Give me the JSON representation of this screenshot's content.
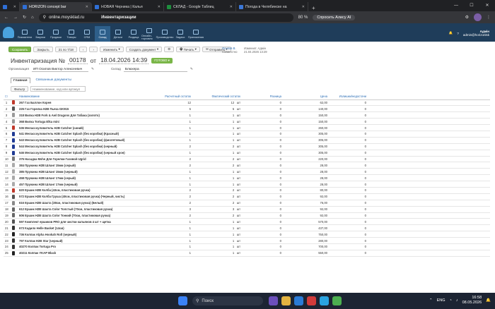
{
  "browser": {
    "tabs": [
      {
        "label": "",
        "color": "#2f6fd6",
        "active": false
      },
      {
        "label": "HORIZON concept bar",
        "color": "#2f6fd6",
        "active": true
      },
      {
        "label": "НОВАЯ Черника | Калья",
        "color": "#2f6fd6",
        "active": false
      },
      {
        "label": "СКЛАД - Google Таблиц",
        "color": "#1e8e3e",
        "active": false
      },
      {
        "label": "Погода в Челябинске на",
        "color": "#3c78d8",
        "active": false
      }
    ],
    "url": "online.moysklad.ru",
    "page_title": "Инвентаризации",
    "zoom": "80 %",
    "alice_label": "Спросить Алису AI"
  },
  "appnav": {
    "items": [
      "Показатели",
      "Закупки",
      "Продажи",
      "Товары",
      "CRM",
      "Склад",
      "Деньги",
      "Роздица",
      "Онлайн-торговля",
      "Производство",
      "Задачи",
      "Приложения"
    ],
    "active_index": 5,
    "user_name": "Адмін",
    "user_email": "admin@horizonlsk"
  },
  "toolbar": {
    "save": "Сохранить",
    "close": "Закрыть",
    "date": "21 по 7/18",
    "change": "Изменить",
    "create_doc": "Создать документ",
    "print": "Печать",
    "send": "Отправить"
  },
  "doc": {
    "prefix": "Инвентаризация №",
    "number": "00178",
    "from": "от",
    "date": "18.04.2026 14:39",
    "status": "ГОТОВО",
    "owner_label": "Осипов В.",
    "owner_sub": "Совместно",
    "changed_label": "Изменил: Адмін",
    "changed_date": "21.04.2026 13:29"
  },
  "form": {
    "org_label": "Организация",
    "org_value": "ИП Осипов Виктор Алексеевич",
    "store_label": "Склад",
    "store_value": "Блюхера"
  },
  "tabs": {
    "main": "Главная",
    "linked": "Связанные документы"
  },
  "filter": {
    "button": "Фильтр",
    "placeholder": "Наименование, код или артикул"
  },
  "table": {
    "headers": [
      "Наименование",
      "Расчетный остаток",
      "Фактический остаток",
      "Разница",
      "Цена",
      "Излишки/недостачи"
    ],
    "unit": "шт",
    "rows": [
      {
        "n": "1",
        "name": "267 Газ Баллон Корея",
        "calc": "12",
        "fact": "12",
        "diff": "0",
        "price": "62,00",
        "sum": "0",
        "color": "#c0392b"
      },
      {
        "n": "2",
        "name": "225 Газ Горелка Н2В Пьеза GK915",
        "calc": "5",
        "fact": "5",
        "diff": "0",
        "price": "140,00",
        "sum": "0",
        "color": "#555"
      },
      {
        "n": "3",
        "name": "318 Вилка Н2В Fork & Awl Dragons Для Табака (золото)",
        "calc": "1",
        "fact": "1",
        "diff": "0",
        "price": "150,00",
        "sum": "0",
        "color": "#999"
      },
      {
        "n": "4",
        "name": "368 Вилка Tortuga Elka mini",
        "calc": "1",
        "fact": "1",
        "diff": "0",
        "price": "150,00",
        "sum": "0",
        "color": "#999"
      },
      {
        "n": "5",
        "name": "536 Мелассоуловитель Н2В Catcher (синий)",
        "calc": "1",
        "fact": "1",
        "diff": "0",
        "price": "260,00",
        "sum": "0",
        "color": "#c0392b"
      },
      {
        "n": "6",
        "name": "541 Мелассоуловитель Н2В Catcher Splash (без коробки) (Красный)",
        "calc": "1",
        "fact": "1",
        "diff": "0",
        "price": "305,00",
        "sum": "0",
        "color": "#1f3a93"
      },
      {
        "n": "7",
        "name": "543 Мелассоуловитель Н2В Catcher Splash (без коробки) (фиолетовый)",
        "calc": "1",
        "fact": "1",
        "diff": "0",
        "price": "305,00",
        "sum": "0",
        "color": "#1f3a93"
      },
      {
        "n": "8",
        "name": "544 Мелассоуловитель Н2В Catcher Splash (без коробки) (черный)",
        "calc": "2",
        "fact": "2",
        "diff": "0",
        "price": "305,00",
        "sum": "0",
        "color": "#1f3a93"
      },
      {
        "n": "9",
        "name": "546 Мелассоуловитель Н2В Catcher Splash (без коробки) (черный хрон)",
        "calc": "1",
        "fact": "1",
        "diff": "0",
        "price": "305,00",
        "sum": "0",
        "color": "#1f3a93"
      },
      {
        "n": "10",
        "name": "375 Насадка Mshe Для Горелки Газовой Ugrid",
        "calc": "2",
        "fact": "2",
        "diff": "0",
        "price": "220,00",
        "sum": "0",
        "color": "#777"
      },
      {
        "n": "11",
        "name": "384 Пружина Н2В Шланг 15мм (серый)",
        "calc": "2",
        "fact": "2",
        "diff": "0",
        "price": "28,00",
        "sum": "0",
        "color": "#aaa"
      },
      {
        "n": "12",
        "name": "385 Пружина Н2В Шланг 15мм (черный)",
        "calc": "1",
        "fact": "1",
        "diff": "0",
        "price": "28,00",
        "sum": "0",
        "color": "#aaa"
      },
      {
        "n": "13",
        "name": "458 Пружина Н2В Шланг 17мм (серый)",
        "calc": "1",
        "fact": "1",
        "diff": "0",
        "price": "28,00",
        "sum": "0",
        "color": "#aaa"
      },
      {
        "n": "14",
        "name": "457 Пружина Н2В Шланг 17мм (черный)",
        "calc": "1",
        "fact": "1",
        "diff": "0",
        "price": "28,00",
        "sum": "0",
        "color": "#aaa"
      },
      {
        "n": "15",
        "name": "620 Ершик Н2В Колба (43см, пластиковая ручка)",
        "calc": "2",
        "fact": "2",
        "diff": "0",
        "price": "80,00",
        "sum": "0",
        "color": "#c0392b"
      },
      {
        "n": "16",
        "name": "572 Ершик Н2В Колба Груша (40см, пластиковая ручка) (Черный, чисть)",
        "calc": "2",
        "fact": "2",
        "diff": "0",
        "price": "92,00",
        "sum": "0",
        "color": "#555"
      },
      {
        "n": "17",
        "name": "616 Ершик Н2В Шахта (38см, пластиковая ручка) (Белый)",
        "calc": "2",
        "fact": "2",
        "diff": "0",
        "price": "76,00",
        "sum": "0",
        "color": "#888"
      },
      {
        "n": "18",
        "name": "612 Ершик Н2В Шахта Color Толстый (70см, пластиковая ручка)",
        "calc": "3",
        "fact": "3",
        "diff": "0",
        "price": "92,00",
        "sum": "0",
        "color": "#666"
      },
      {
        "n": "19",
        "name": "606 Ершик Н2В Шахта Color Тонкий (70см, пластиковая ручка)",
        "calc": "2",
        "fact": "2",
        "diff": "0",
        "price": "92,00",
        "sum": "0",
        "color": "#666"
      },
      {
        "n": "20",
        "name": "597 Комплект ершиков PRO для чистки кальянов 4 шт + щетка",
        "calc": "1",
        "fact": "1",
        "diff": "0",
        "price": "570,00",
        "sum": "0",
        "color": "#555"
      },
      {
        "n": "21",
        "name": "673 Кадило Helle Basket (14см)",
        "calc": "1",
        "fact": "1",
        "diff": "0",
        "price": "437,00",
        "sum": "0",
        "color": "#333"
      },
      {
        "n": "22",
        "name": "736 Колпак Alpha Hookah Roll (черный)",
        "calc": "1",
        "fact": "1",
        "diff": "0",
        "price": "750,00",
        "sum": "0",
        "color": "#222"
      },
      {
        "n": "23",
        "name": "797 Колпак Н2В Star (черный)",
        "calc": "1",
        "fact": "1",
        "diff": "0",
        "price": "280,00",
        "sum": "0",
        "color": "#333"
      },
      {
        "n": "24",
        "name": "40270 Колпак Tortuga Pro",
        "calc": "1",
        "fact": "1",
        "diff": "0",
        "price": "700,00",
        "sum": "0",
        "color": "#333"
      },
      {
        "n": "25",
        "name": "40211 Колпак YKAP Black",
        "calc": "1",
        "fact": "1",
        "diff": "0",
        "price": "550,00",
        "sum": "0",
        "color": "#222"
      }
    ]
  },
  "taskbar": {
    "search": "Поиск",
    "lang": "ENG",
    "time": "16:58",
    "date": "08.05.2026"
  }
}
